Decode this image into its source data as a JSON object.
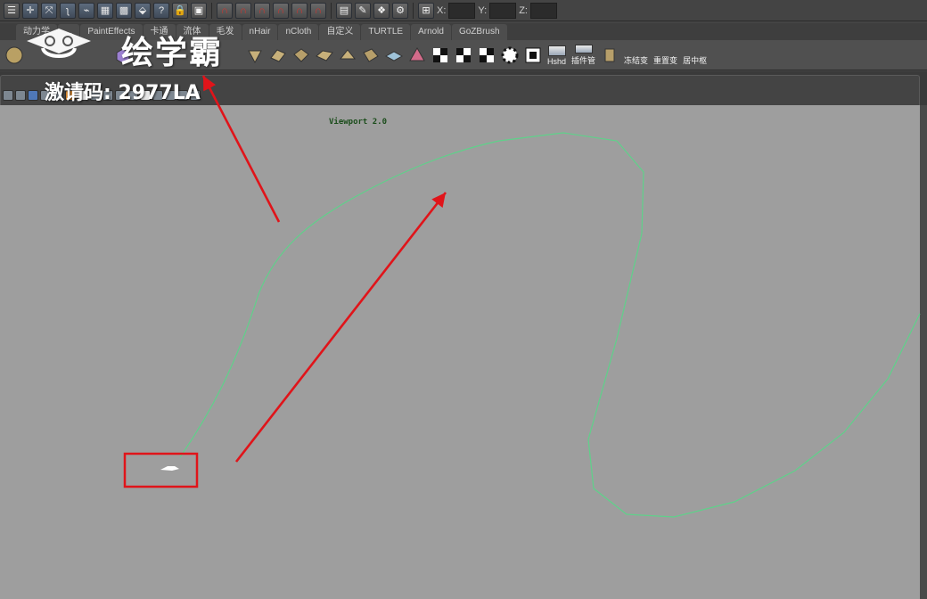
{
  "topbar": {
    "icons": [
      "menu-icon",
      "select-icon",
      "move-icon",
      "lasso-icon",
      "paint-icon",
      "snap-grid-icon",
      "snap-curve-icon",
      "snap-point-icon",
      "help-icon",
      "history-icon",
      "render-icon",
      "camera-icon",
      "magnet-icon",
      "magnet-icon",
      "magnet-icon",
      "magnet-icon",
      "magnet-icon",
      "render-view-icon",
      "ipr-icon",
      "hypershade-icon",
      "render-settings-icon",
      "input-mode-icon"
    ],
    "coords": {
      "x_label": "X:",
      "y_label": "Y:",
      "z_label": "Z:"
    }
  },
  "shelf_tabs": [
    "动力学",
    "...",
    "PaintEffects",
    "卡通",
    "流体",
    "毛发",
    "nHair",
    "nCloth",
    "自定义",
    "TURTLE",
    "Arnold",
    "GoZBrush"
  ],
  "shelf_icons": {
    "labels": [
      "Hshd",
      "插件管",
      "冻结变",
      "重置变",
      "居中枢"
    ]
  },
  "viewport": {
    "label": "Viewport 2.0",
    "background": "#9e9e9e",
    "curve_color": "#5fd18a"
  },
  "watermark": {
    "brand": "绘学霸",
    "code": "激请码: 2977LA"
  },
  "annotation": {
    "color": "#e0141a"
  }
}
